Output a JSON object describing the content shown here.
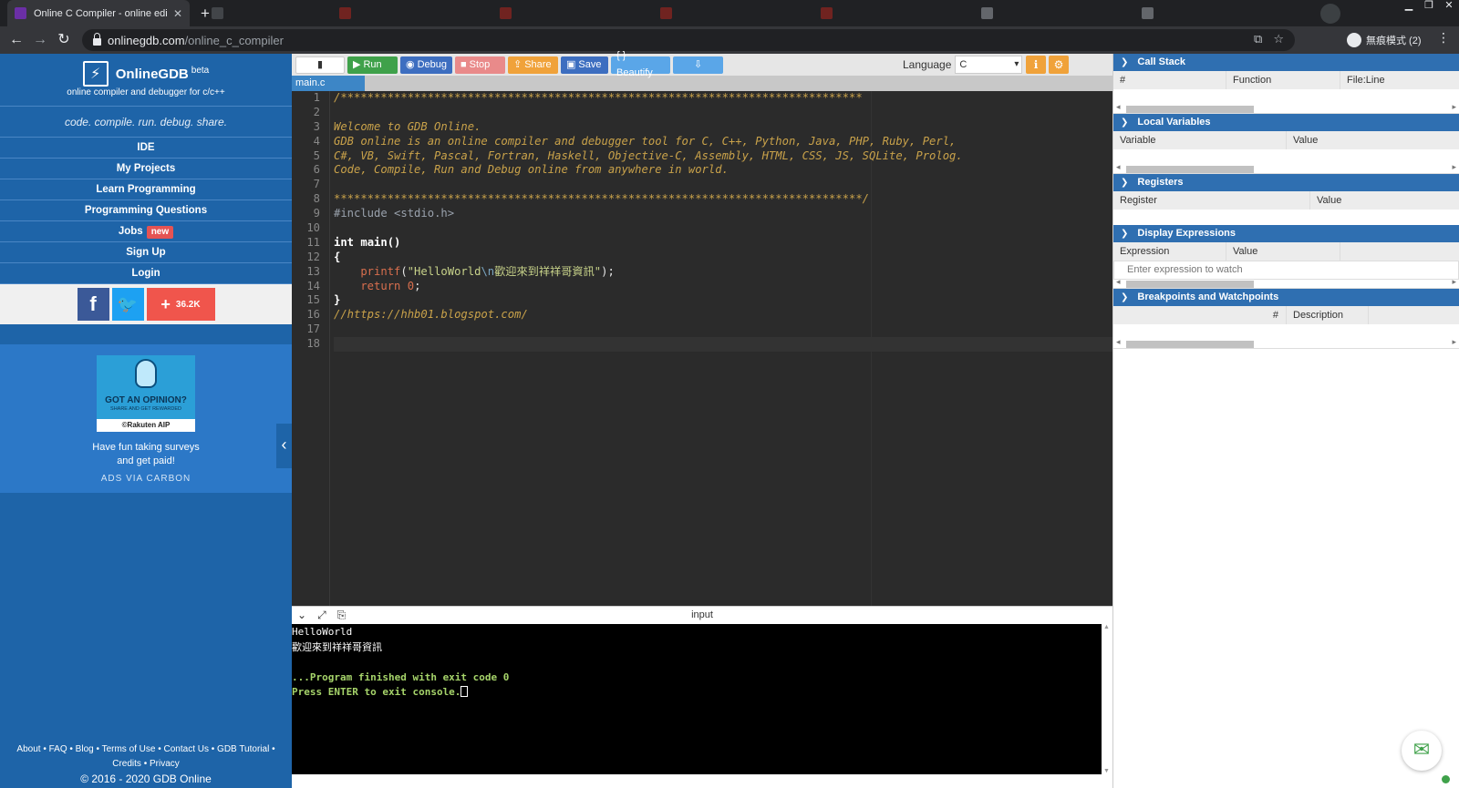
{
  "browser": {
    "active_tab_title": "Online C Compiler - online edi",
    "url_host": "onlinegdb.com",
    "url_path": "/online_c_compiler",
    "profile_label": "無痕模式 (2)"
  },
  "brand": {
    "name": "OnlineGDB",
    "beta": "beta",
    "subtitle": "online compiler and debugger for c/c++",
    "tagline": "code. compile. run. debug. share."
  },
  "menu": [
    {
      "label": "IDE"
    },
    {
      "label": "My Projects"
    },
    {
      "label": "Learn Programming"
    },
    {
      "label": "Programming Questions"
    },
    {
      "label": "Jobs",
      "badge": "new"
    },
    {
      "label": "Sign Up"
    },
    {
      "label": "Login"
    }
  ],
  "social": {
    "share_count": "36.2K"
  },
  "ad": {
    "headline": "GOT AN OPINION?",
    "sub": "SHARE AND GET REWARDED",
    "brand": "©Rakuten AIP",
    "text_line1": "Have fun taking surveys",
    "text_line2": "and get paid!",
    "via": "ADS VIA CARBON"
  },
  "footer": {
    "links_line1": "About • FAQ • Blog • Terms of Use • Contact Us • GDB Tutorial •",
    "links_line2": "Credits • Privacy",
    "copyright": "© 2016 - 2020 GDB Online"
  },
  "toolbar": {
    "run": "Run",
    "debug": "Debug",
    "stop": "Stop",
    "share": "Share",
    "save": "Save",
    "beautify": "{ } Beautify",
    "language_label": "Language",
    "language_value": "C"
  },
  "file_tab": "main.c",
  "code": {
    "line_numbers": [
      "1",
      "2",
      "3",
      "4",
      "5",
      "6",
      "7",
      "8",
      "9",
      "10",
      "11",
      "12",
      "13",
      "14",
      "15",
      "16",
      "17",
      "18"
    ],
    "l1": "/******************************************************************************",
    "l3": "Welcome to GDB Online.",
    "l4": "GDB online is an online compiler and debugger tool for C, C++, Python, Java, PHP, Ruby, Perl,",
    "l5": "C#, VB, Swift, Pascal, Fortran, Haskell, Objective-C, Assembly, HTML, CSS, JS, SQLite, Prolog.",
    "l6": "Code, Compile, Run and Debug online from anywhere in world.",
    "l8": "*******************************************************************************/",
    "l9_directive": "#include",
    "l9_header": " <stdio.h>",
    "l11_kw": "int",
    "l11_rest": " main()",
    "l12": "{",
    "l13_func": "    printf",
    "l13_open": "(",
    "l13_str1": "\"HelloWorld",
    "l13_esc": "\\n",
    "l13_str2": "歡迎來到祥祥哥資訊\"",
    "l13_close": ");",
    "l14_kw": "    return",
    "l14_num": " 0",
    "l14_semi": ";",
    "l15": "}",
    "l16": "//https://hhb01.blogspot.com/"
  },
  "console": {
    "title": "input",
    "line1": "HelloWorld",
    "line2": "歡迎來到祥祥哥資訊",
    "line3": "...Program finished with exit code 0",
    "line4": "Press ENTER to exit console."
  },
  "panels": {
    "call_stack": {
      "title": "Call Stack",
      "cols": [
        "#",
        "Function",
        "File:Line"
      ]
    },
    "local_vars": {
      "title": "Local Variables",
      "cols": [
        "Variable",
        "Value"
      ]
    },
    "registers": {
      "title": "Registers",
      "cols": [
        "Register",
        "Value"
      ]
    },
    "display_expr": {
      "title": "Display Expressions",
      "cols": [
        "Expression",
        "Value"
      ],
      "placeholder": "Enter expression to watch"
    },
    "breakpoints": {
      "title": "Breakpoints and Watchpoints",
      "cols": [
        "#",
        "Description"
      ]
    }
  }
}
